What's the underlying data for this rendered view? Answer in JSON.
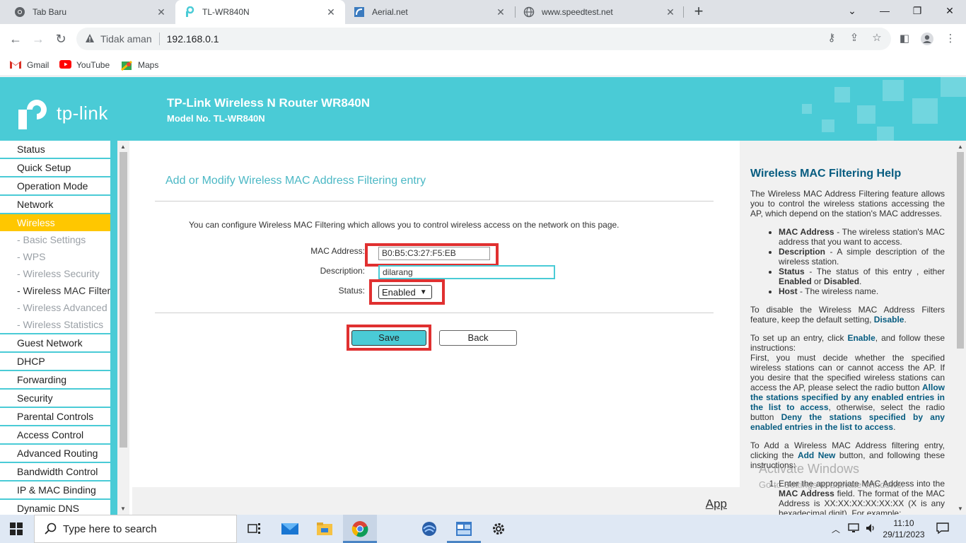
{
  "browser": {
    "tabs": [
      {
        "title": "Tab Baru",
        "icon": "chrome-icon",
        "active": false
      },
      {
        "title": "TL-WR840N",
        "icon": "tplink-icon",
        "active": true
      },
      {
        "title": "Aerial.net",
        "icon": "aerial-icon",
        "active": false
      },
      {
        "title": "www.speedtest.net",
        "icon": "globe-icon",
        "active": false
      }
    ],
    "security_label": "Tidak aman",
    "url": "192.168.0.1",
    "bookmarks": [
      {
        "label": "Gmail",
        "icon": "gmail-icon"
      },
      {
        "label": "YouTube",
        "icon": "youtube-icon"
      },
      {
        "label": "Maps",
        "icon": "maps-icon"
      }
    ]
  },
  "router": {
    "logo_text": "tp-link",
    "title": "TP-Link Wireless N Router WR840N",
    "model": "Model No. TL-WR840N",
    "menu": [
      {
        "label": "Status",
        "type": "main"
      },
      {
        "label": "Quick Setup",
        "type": "main"
      },
      {
        "label": "Operation Mode",
        "type": "main"
      },
      {
        "label": "Network",
        "type": "main"
      },
      {
        "label": "Wireless",
        "type": "active"
      },
      {
        "label": "- Basic Settings",
        "type": "sub"
      },
      {
        "label": "- WPS",
        "type": "sub"
      },
      {
        "label": "- Wireless Security",
        "type": "sub"
      },
      {
        "label": "- Wireless MAC Filtering",
        "type": "current"
      },
      {
        "label": "- Wireless Advanced",
        "type": "sub"
      },
      {
        "label": "- Wireless Statistics",
        "type": "sub"
      },
      {
        "label": "Guest Network",
        "type": "main"
      },
      {
        "label": "DHCP",
        "type": "main"
      },
      {
        "label": "Forwarding",
        "type": "main"
      },
      {
        "label": "Security",
        "type": "main"
      },
      {
        "label": "Parental Controls",
        "type": "main"
      },
      {
        "label": "Access Control",
        "type": "main"
      },
      {
        "label": "Advanced Routing",
        "type": "main"
      },
      {
        "label": "Bandwidth Control",
        "type": "main"
      },
      {
        "label": "IP & MAC Binding",
        "type": "main"
      },
      {
        "label": "Dynamic DNS",
        "type": "main"
      }
    ]
  },
  "form": {
    "heading": "Add or Modify Wireless MAC Address Filtering entry",
    "intro": "You can configure Wireless MAC Filtering which allows you to control wireless access on the network on this page.",
    "mac_label": "MAC Address:",
    "mac_value": "B0:B5:C3:27:F5:EB",
    "desc_label": "Description:",
    "desc_value": "dilarang",
    "status_label": "Status:",
    "status_value": "Enabled",
    "save_label": "Save",
    "back_label": "Back",
    "app_link": "App",
    "highlight_color": "#e03030"
  },
  "help": {
    "title": "Wireless MAC Filtering Help",
    "p1": "The Wireless MAC Address Filtering feature allows you to control the wireless stations accessing the AP, which depend on the station's MAC addresses.",
    "items": [
      {
        "term": "MAC Address",
        "text": " - The wireless station's MAC address that you want to access."
      },
      {
        "term": "Description",
        "text": " - A simple description of the wireless station."
      },
      {
        "term": "Status",
        "text": " - The status of this entry , either "
      },
      {
        "term": "Host",
        "text": " - The wireless name."
      }
    ],
    "status_enabled": "Enabled",
    "status_or": " or ",
    "status_disabled": "Disabled",
    "status_end": ".",
    "p2_pre": "To disable the Wireless MAC Address Filters feature, keep the default setting, ",
    "p2_link": "Disable",
    "p2_end": ".",
    "p3_pre": "To set up an entry, click ",
    "p3_link": "Enable",
    "p3_mid": ", and follow these instructions:",
    "p3_b": "First, you must decide whether the specified wireless stations can or cannot access the AP. If you desire that the specified wireless stations can access the AP, please select the radio button ",
    "p3_allow": "Allow the stations specified by any enabled entries in the list to access",
    "p3_c": ", otherwise, select the radio button ",
    "p3_deny": "Deny the stations specified by any enabled entries in the list to access",
    "p3_end": ".",
    "p4_pre": "To Add a Wireless MAC Address filtering entry, clicking the ",
    "p4_link": "Add New",
    "p4_end": " button, and following these instructions:",
    "ol1_pre": "Enter the appropriate MAC Address into the ",
    "ol1_term": "MAC Address",
    "ol1_text": " field. The format of the MAC Address is XX:XX:XX:XX:XX:XX (X is any hexadecimal digit). For example:"
  },
  "windows": {
    "watermark": "Activate Windows",
    "watermark_sub": "Go to Settings to activate Windows.",
    "search_placeholder": "Type here to search",
    "time": "11:10",
    "date": "29/11/2023"
  }
}
